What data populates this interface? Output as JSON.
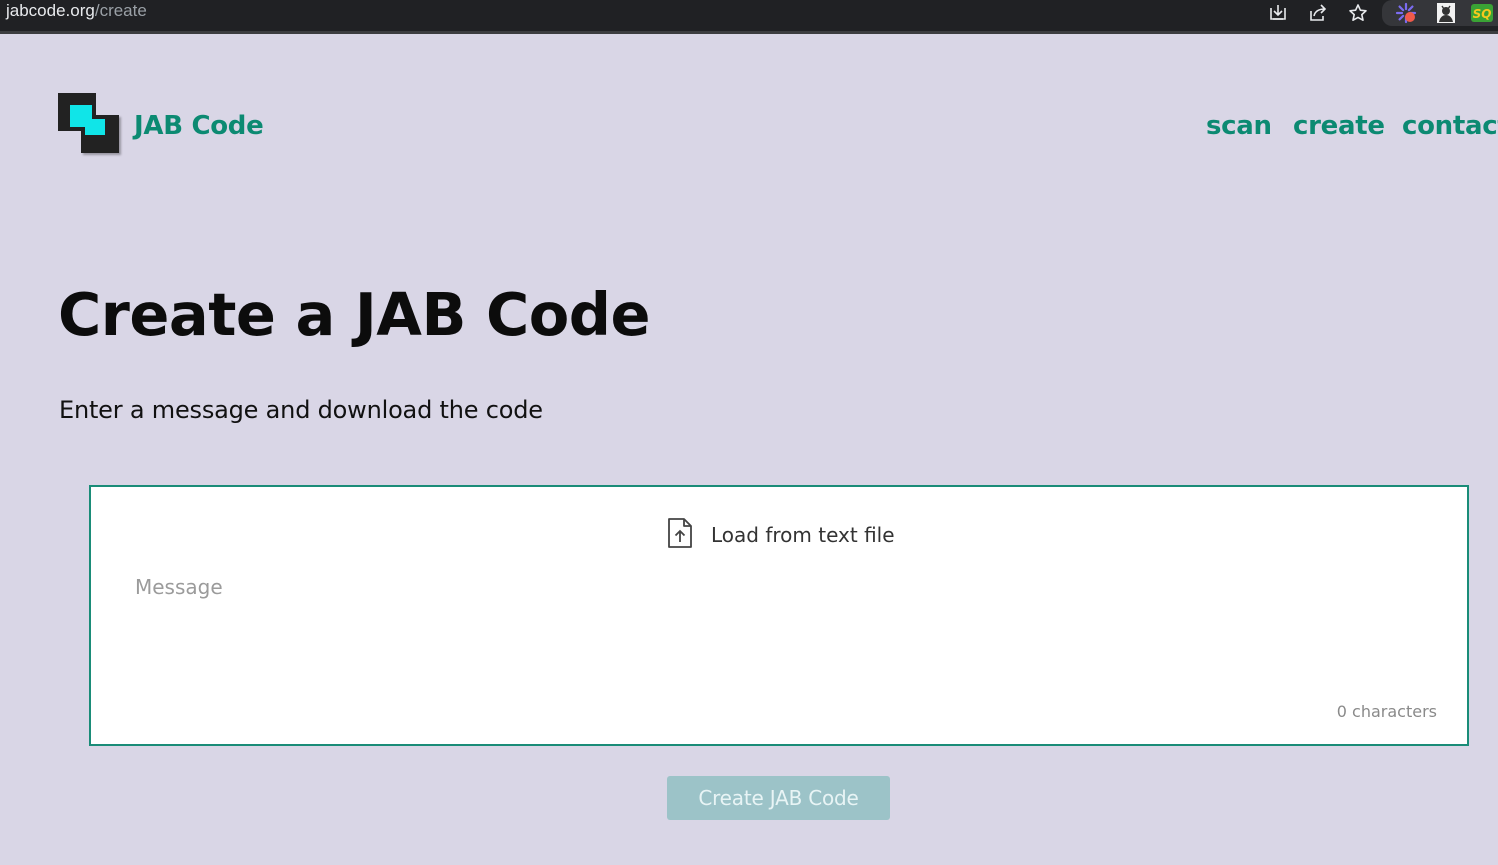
{
  "browser": {
    "url_domain": "jabcode.org",
    "url_path": "/create",
    "icons": [
      "install-icon",
      "share-icon",
      "bookmark-star-icon",
      "extension-icon",
      "profile-extension-icon",
      "seoquake-icon"
    ],
    "ext_label": "SQ"
  },
  "header": {
    "brand": "JAB Code",
    "nav": {
      "scan": "scan",
      "create": "create",
      "contact": "contact"
    }
  },
  "main": {
    "title": "Create a JAB Code",
    "subtitle": "Enter a message and download the code",
    "load_label": "Load from text file",
    "message_placeholder": "Message",
    "message_value": "",
    "char_count": "0 characters",
    "create_button": "Create JAB Code"
  },
  "colors": {
    "accent": "#0c8a72",
    "background": "#d9d6e6",
    "button_disabled": "#9cc3c8",
    "logo_cyan": "#10e5e8"
  }
}
